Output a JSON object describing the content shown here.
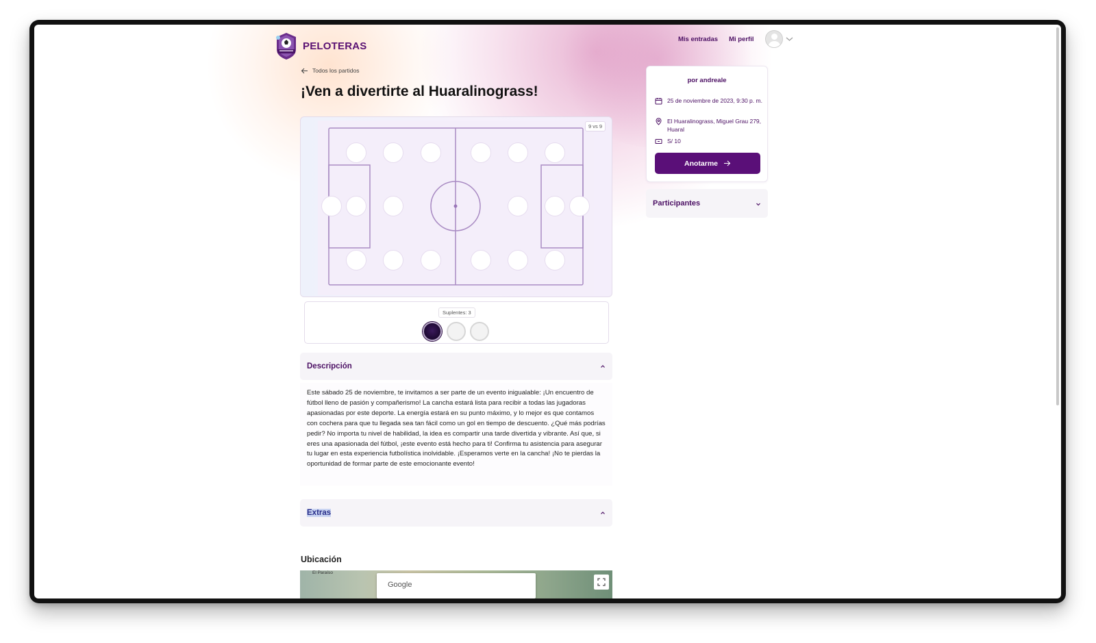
{
  "brand": {
    "name": "PELOTERAS",
    "accent": "#5a0f78"
  },
  "nav": {
    "my_tickets": "Mis entradas",
    "my_profile": "Mi perfil",
    "avatar_icon": "user-avatar-icon",
    "menu_icon": "chevron-down-icon"
  },
  "back_link": {
    "label": "Todos los partidos",
    "icon": "arrow-left-icon"
  },
  "event": {
    "title": "¡Ven a divertirte al Huaralinograss!"
  },
  "pitch": {
    "format_label": "9 vs 9",
    "slots_total": 20,
    "slots_filled": 0,
    "substitutes_label": "Suplentes: 3",
    "substitutes_total": 3,
    "substitutes_filled": 1
  },
  "description": {
    "title": "Descripción",
    "expanded": true,
    "text": "Este sábado 25 de noviembre, te invitamos a ser parte de un evento inigualable: ¡Un encuentro de fútbol lleno de pasión y compañerismo! La cancha estará lista para recibir a todas las jugadoras apasionadas por este deporte. La energía estará en su punto máximo, y lo mejor es que contamos con cochera para que tu llegada sea tan fácil como un gol en tiempo de descuento. ¿Qué más podrías pedir? No importa tu nivel de habilidad, la idea es compartir una tarde divertida y vibrante. Así que, si eres una apasionada del fútbol, ¡este evento está hecho para ti! Confirma tu asistencia para asegurar tu lugar en esta experiencia futbolística inolvidable. ¡Esperamos verte en la cancha! ¡No te pierdas la oportunidad de formar parte de este emocionante evento!"
  },
  "extras": {
    "title": "Extras",
    "expanded": true
  },
  "location": {
    "title": "Ubicación",
    "map_search_text": "Google",
    "map_place_label": "El Paraíso",
    "fullscreen_icon": "fullscreen-icon"
  },
  "sidebar": {
    "organizer": "por andreale",
    "date": "25 de noviembre de 2023, 9:30 p. m.",
    "date_icon": "calendar-icon",
    "address": "El Huaralinograss, Miguel Grau 279, Huaral",
    "address_icon": "map-pin-icon",
    "price": "S/ 10",
    "price_icon": "ticket-icon",
    "cta_label": "Anotarme",
    "cta_icon": "arrow-right-icon"
  },
  "participants": {
    "title": "Participantes",
    "expanded": false
  }
}
